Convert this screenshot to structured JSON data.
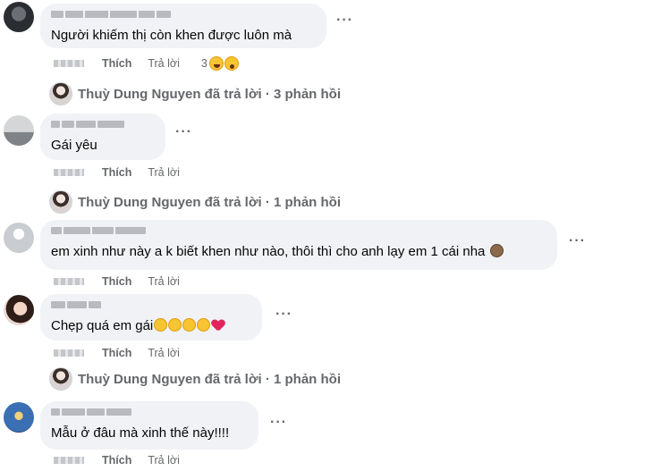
{
  "comments": [
    {
      "text": "Người khiếm thị còn khen được luôn mà",
      "like_label": "Thích",
      "reply_label": "Trả lời",
      "reaction_count": "3",
      "reactions": [
        "haha-emoji",
        "wow-emoji"
      ],
      "more_label": "···",
      "reply_summary": "Thuỳ Dung Nguyen đã trả lời · 3 phản hồi"
    },
    {
      "text": "Gái yêu",
      "like_label": "Thích",
      "reply_label": "Trả lời",
      "more_label": "···",
      "reply_summary": "Thuỳ Dung Nguyen đã trả lời · 1 phản hồi"
    },
    {
      "text": "em xinh như này a k biết khen như nào, thôi thì cho anh lạy em 1 cái nha",
      "like_label": "Thích",
      "reply_label": "Trả lời",
      "more_label": "···"
    },
    {
      "text": "Chẹp quá em gái",
      "like_label": "Thích",
      "reply_label": "Trả lời",
      "more_label": "···",
      "reply_summary": "Thuỳ Dung Nguyen đã trả lời · 1 phản hồi"
    },
    {
      "text": "Mẫu ở đâu mà xinh thế này!!!!",
      "like_label": "Thích",
      "reply_label": "Trả lời",
      "more_label": "···"
    }
  ],
  "colors": {
    "bubble": "#f0f2f5",
    "secondary_text": "#65676b",
    "primary_text": "#050505"
  }
}
